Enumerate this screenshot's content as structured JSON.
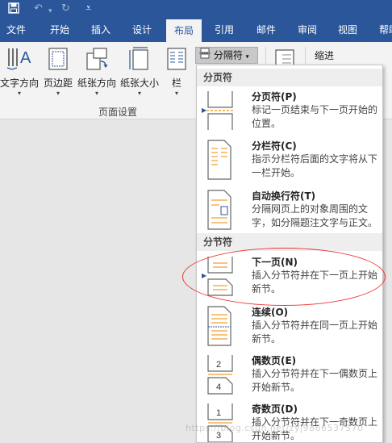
{
  "quick_access": {
    "undo": "↶",
    "redo": "↻",
    "customize": "⩡"
  },
  "tabs": [
    "文件",
    "开始",
    "插入",
    "设计",
    "布局",
    "引用",
    "邮件",
    "审阅",
    "视图",
    "帮助"
  ],
  "ribbon": {
    "buttons": [
      {
        "label": "文字方向"
      },
      {
        "label": "页边距"
      },
      {
        "label": "纸张方向"
      },
      {
        "label": "纸张大小"
      },
      {
        "label": "栏"
      }
    ],
    "group_label": "页面设置",
    "breaks_button": "分隔符",
    "indent_label": "缩进"
  },
  "menu": {
    "page_breaks_header": "分页符",
    "section_breaks_header": "分节符",
    "items": [
      {
        "title": "分页符(P)",
        "desc": "标记一页结束与下一页开始的位置。"
      },
      {
        "title": "分栏符(C)",
        "desc": "指示分栏符后面的文字将从下一栏开始。"
      },
      {
        "title": "自动换行符(T)",
        "desc": "分隔网页上的对象周围的文字，如分隔题注文字与正文。"
      },
      {
        "title": "下一页(N)",
        "desc": "插入分节符并在下一页上开始新节。"
      },
      {
        "title": "连续(O)",
        "desc": "插入分节符并在同一页上开始新节。"
      },
      {
        "title": "偶数页(E)",
        "desc": "插入分节符并在下一偶数页上开始新节。"
      },
      {
        "title": "奇数页(D)",
        "desc": "插入分节符并在下一奇数页上开始新节。"
      }
    ]
  },
  "watermark": "https://blog.csdn.net/zyj9866537570",
  "colors": {
    "accent": "#2b579a",
    "annotation": "#e33333"
  }
}
